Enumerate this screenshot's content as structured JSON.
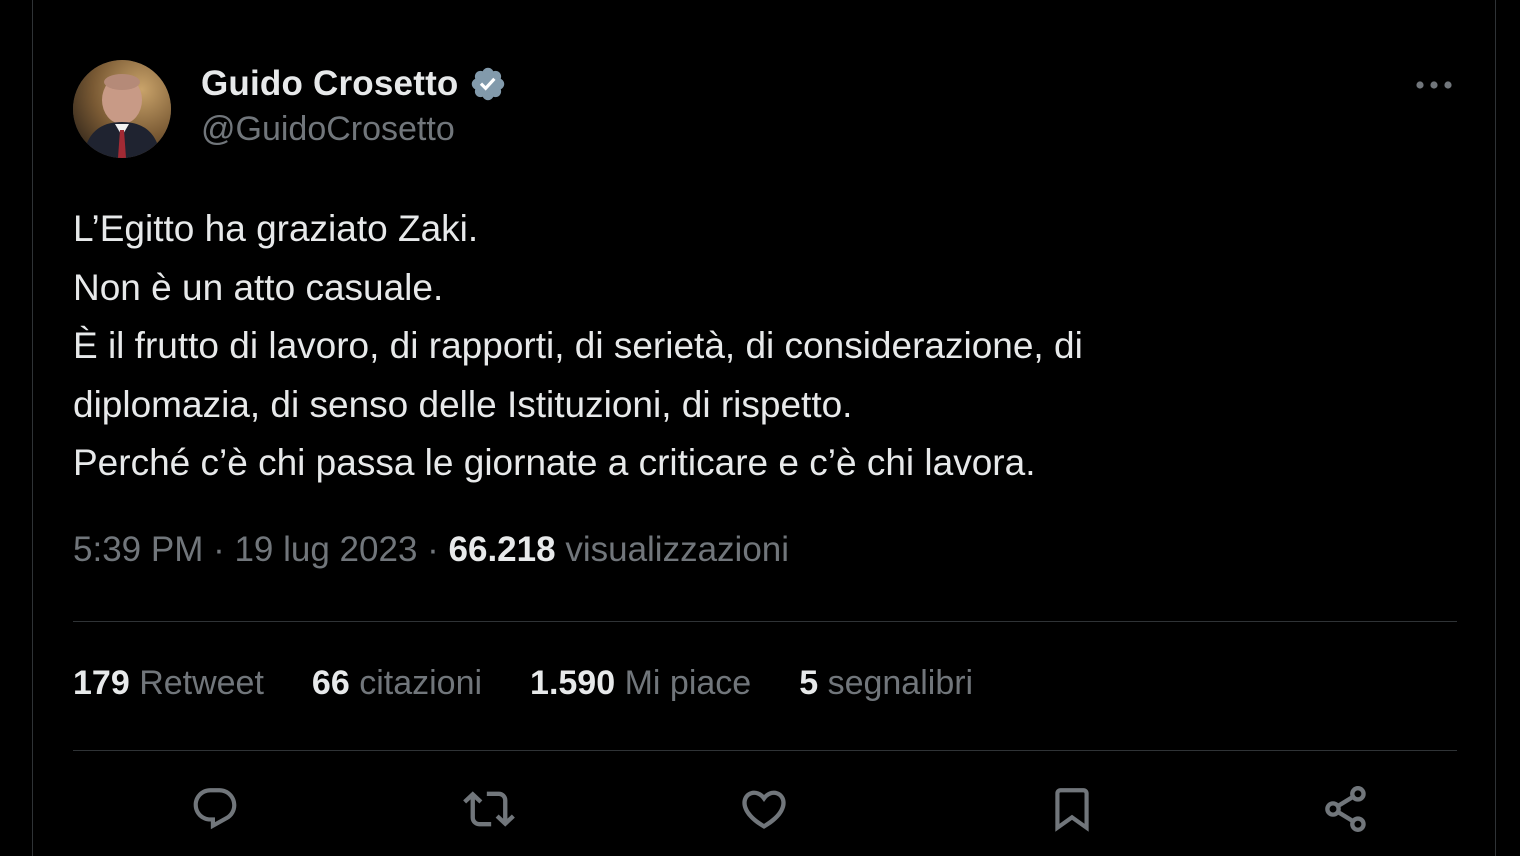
{
  "author": {
    "name": "Guido Crosetto",
    "handle": "@GuidoCrosetto",
    "verified": true
  },
  "icons": {
    "more": "more-horizontal-icon",
    "verified": "verified-badge-icon",
    "reply": "reply-icon",
    "retweet": "retweet-icon",
    "like": "heart-icon",
    "bookmark": "bookmark-icon",
    "share": "share-icon"
  },
  "tweet": {
    "lines": [
      "L’Egitto ha graziato Zaki.",
      "Non è un atto casuale.",
      "È il frutto di lavoro, di rapporti, di serietà, di considerazione, di",
      "diplomazia, di senso delle Istituzioni, di rispetto.",
      "Perché c’è chi passa le giornate a criticare e c’è chi lavora."
    ]
  },
  "meta": {
    "time": "5:39 PM",
    "separator": " · ",
    "date": "19 lug 2023",
    "views_count": "66.218",
    "views_label": "visualizzazioni"
  },
  "stats": [
    {
      "count": "179",
      "label": "Retweet"
    },
    {
      "count": "66",
      "label": "citazioni"
    },
    {
      "count": "1.590",
      "label": "Mi piace"
    },
    {
      "count": "5",
      "label": "segnalibri"
    }
  ],
  "colors": {
    "background": "#000000",
    "text_primary": "#e7e9ea",
    "text_secondary": "#71767b",
    "border": "#2f3336",
    "verified_badge": "#829aab"
  }
}
